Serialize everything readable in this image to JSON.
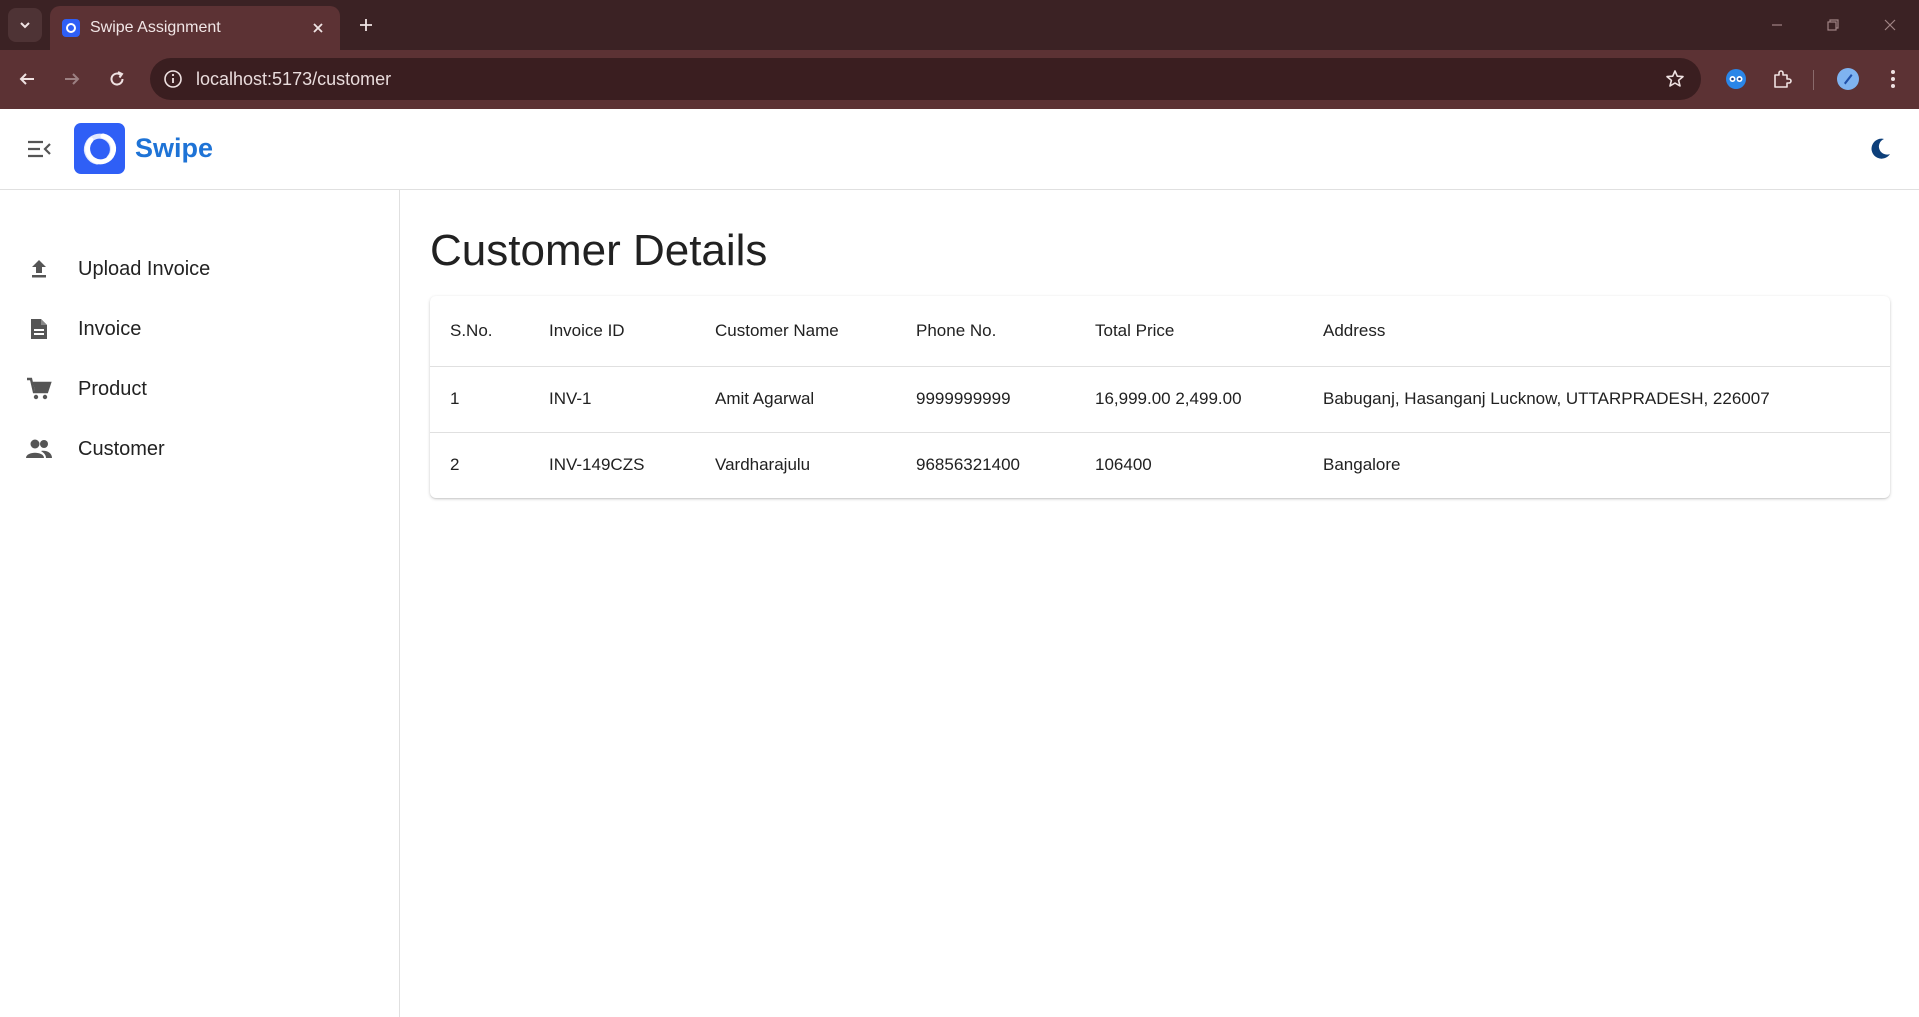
{
  "browser": {
    "tab_title": "Swipe Assignment",
    "url": "localhost:5173/customer"
  },
  "app": {
    "brand": "Swipe"
  },
  "sidebar": {
    "items": [
      {
        "label": "Upload Invoice",
        "icon": "upload-icon"
      },
      {
        "label": "Invoice",
        "icon": "document-icon"
      },
      {
        "label": "Product",
        "icon": "cart-icon"
      },
      {
        "label": "Customer",
        "icon": "people-icon"
      }
    ]
  },
  "main": {
    "title": "Customer Details",
    "table": {
      "headers": [
        "S.No.",
        "Invoice ID",
        "Customer Name",
        "Phone No.",
        "Total Price",
        "Address"
      ],
      "rows": [
        [
          "1",
          "INV-1",
          "Amit Agarwal",
          "9999999999",
          "16,999.00 2,499.00",
          "Babuganj, Hasanganj Lucknow, UTTARPRADESH, 226007"
        ],
        [
          "2",
          "INV-149CZS",
          "Vardharajulu",
          "96856321400",
          "106400",
          "Bangalore"
        ]
      ]
    }
  },
  "colors": {
    "chrome_dark": "#3b2224",
    "chrome_tab": "#5c3234",
    "brand_blue": "#1e73d6",
    "logo_blue": "#2f5ff6",
    "moon": "#0d3f7a"
  }
}
